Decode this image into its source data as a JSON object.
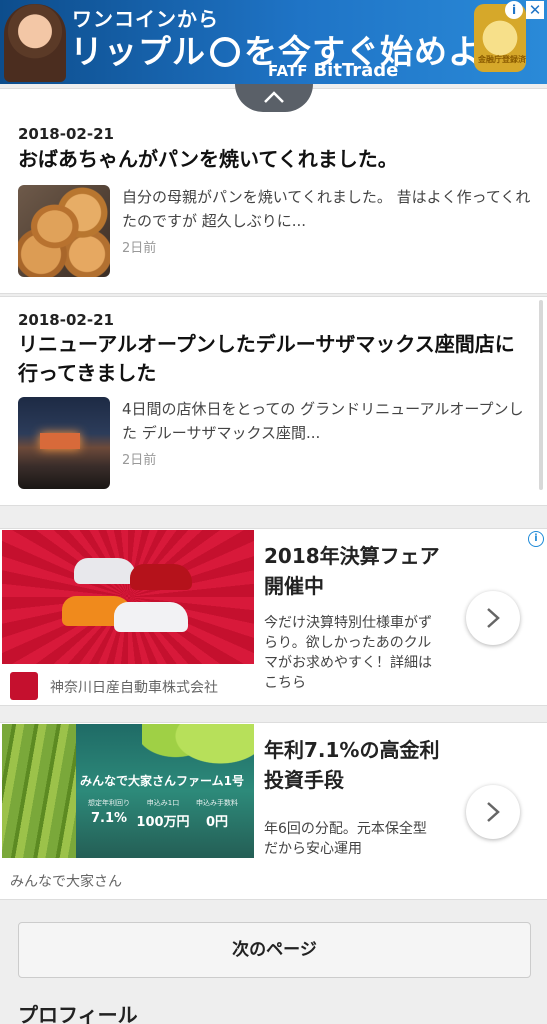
{
  "top_ad": {
    "line1": "ワンコインから",
    "line2_a": "リップル",
    "line2_b": "を今すぐ始めよう！",
    "brand_a": "FATF",
    "brand_b": "BitTrade",
    "badge": "金融庁登録済",
    "info_icon": "info-icon",
    "close_icon": "close-icon"
  },
  "articles": [
    {
      "date": "2018-02-21",
      "title": "おばあちゃんがパンを焼いてくれました。",
      "excerpt": "自分の母親がパンを焼いてくれました。 昔はよく作ってくれたのですが 超久しぶりに...",
      "ago": "2日前"
    },
    {
      "date": "2018-02-21",
      "title": "リニューアルオープンしたデルーサザマックス座間店に行ってきました",
      "excerpt": "4日間の店休日をとっての グランドリニューアルオープンした デルーサザマックス座間...",
      "ago": "2日前"
    }
  ],
  "ads": [
    {
      "headline": "2018年決算フェア開催中",
      "body": "今だけ決算特別仕様車がずらり。欲しかったあのクルマがお求めやすく！詳細はこちら",
      "advertiser": "神奈川日産自動車株式会社"
    },
    {
      "headline": "年利7.1%の高金利投資手段",
      "body": "年6回の分配。元本保全型だから安心運用",
      "advertiser": "みんなで大家さん",
      "image_caption": "みんなで大家さんファーム1号",
      "stats": [
        {
          "k": "想定年利回り",
          "v": "7.1%"
        },
        {
          "k": "申込み1口",
          "v": "100万円"
        },
        {
          "k": "申込み手数料",
          "v": "0円"
        }
      ]
    }
  ],
  "next_page_label": "次のページ",
  "profile_heading": "プロフィール",
  "colors": {
    "top_ad_blue": "#1f74c6",
    "nissan_red": "#c5102e",
    "ad_info_blue": "#1f8ad8"
  }
}
